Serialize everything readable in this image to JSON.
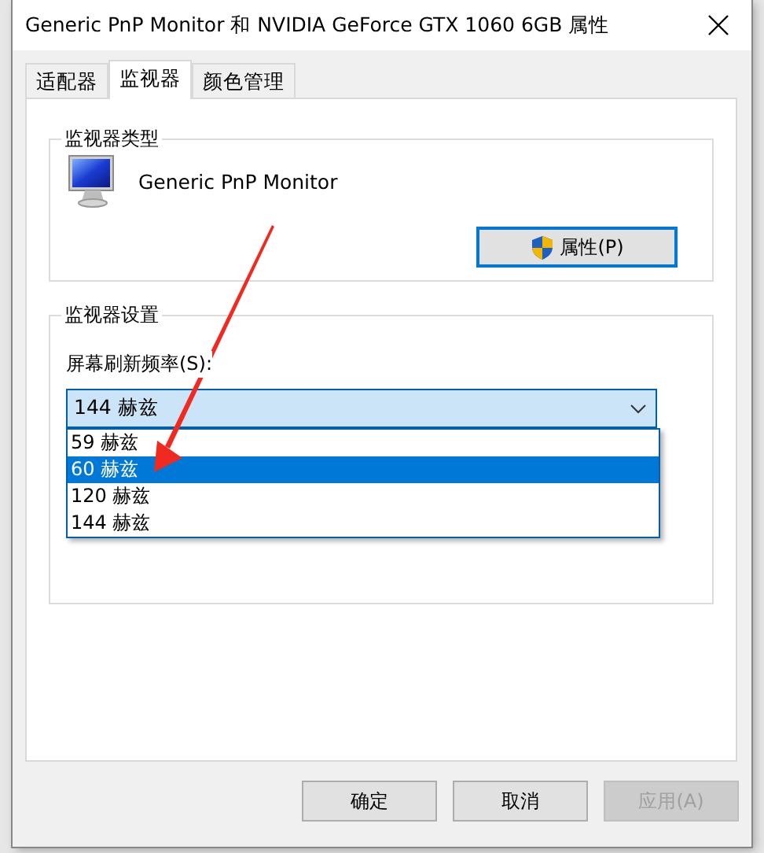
{
  "window": {
    "title": "Generic PnP Monitor 和 NVIDIA GeForce GTX 1060 6GB 属性"
  },
  "tabs": [
    {
      "label": "适配器",
      "selected": false
    },
    {
      "label": "监视器",
      "selected": true
    },
    {
      "label": "颜色管理",
      "selected": false
    }
  ],
  "monitor_type": {
    "title": "监视器类型",
    "name": "Generic PnP Monitor",
    "button": "属性(P)"
  },
  "monitor_settings": {
    "title": "监视器设置",
    "refresh_label": "屏幕刷新频率(S):",
    "refresh_value": "144 赫兹",
    "options": [
      {
        "label": "59 赫兹",
        "selected": false
      },
      {
        "label": "60 赫兹",
        "selected": true
      },
      {
        "label": "120 赫兹",
        "selected": false
      },
      {
        "label": "144 赫兹",
        "selected": false
      }
    ]
  },
  "buttons": [
    {
      "label": "确定",
      "disabled": false
    },
    {
      "label": "取消",
      "disabled": false
    },
    {
      "label": "应用(A)",
      "disabled": true
    }
  ]
}
